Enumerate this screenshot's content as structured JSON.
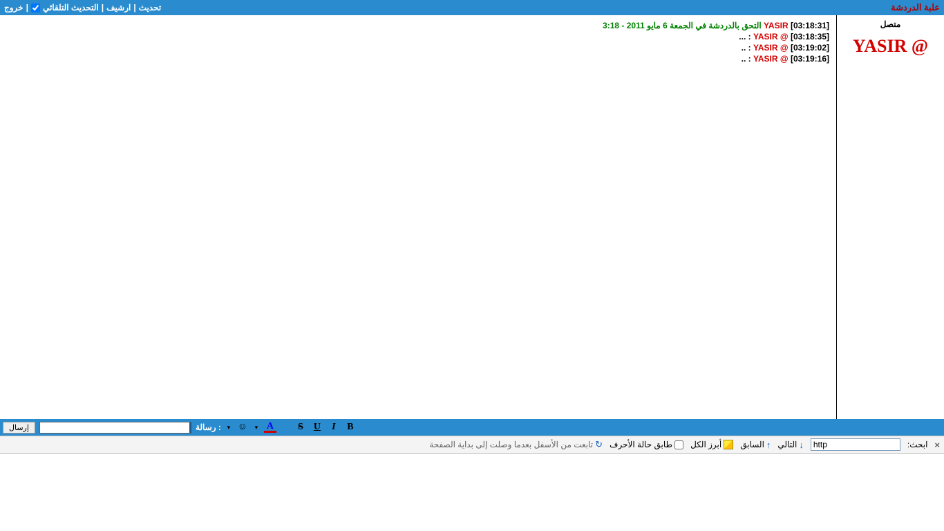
{
  "header": {
    "title": "علبة الدردشة",
    "links": {
      "refresh": "تحديث",
      "archive": "ارشيف",
      "auto_refresh": "التحديث التلقائي",
      "logout": "خروج"
    },
    "auto_refresh_checked": true
  },
  "users": {
    "status_label": "متصل",
    "current_user": "@ YASIR"
  },
  "chat": {
    "lines": [
      {
        "ts": "[03:18:31]",
        "user": "YASIR",
        "type": "join",
        "text": "التحق بالدردشة في الجمعة 6 مايو 2011 - 3:18"
      },
      {
        "ts": "[03:18:35]",
        "user": "@ YASIR",
        "type": "msg",
        "text": ": ..."
      },
      {
        "ts": "[03:19:02]",
        "user": "@ YASIR",
        "type": "msg",
        "text": ": .."
      },
      {
        "ts": "[03:19:16]",
        "user": "@ YASIR",
        "type": "msg",
        "text": ": .."
      }
    ]
  },
  "compose": {
    "send": "إرسال",
    "label": "رسالة :",
    "icons": {
      "bold": "B",
      "italic": "I",
      "underline": "U",
      "strike": "S",
      "fontcolor": "A",
      "smiley": "☺",
      "arrow": "▾"
    }
  },
  "findbar": {
    "close": "×",
    "label": "ابحث:",
    "value": "http",
    "next": "التالي",
    "prev": "السابق",
    "highlight": "أبرز الكل",
    "matchcase": "طابق حالة الأحرف",
    "wrapped": "تابعت من الأسفل بعدما وصلت إلى بداية الصفحة",
    "arrow_down": "↓",
    "arrow_up": "↑",
    "wrap_icon": "↻"
  }
}
